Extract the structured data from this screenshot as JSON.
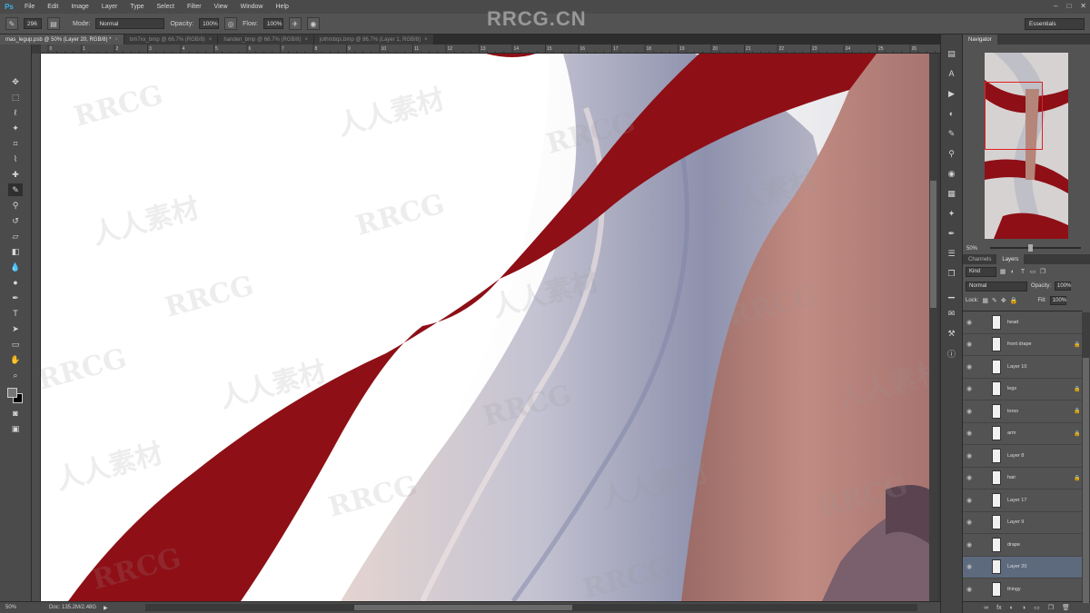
{
  "app": {
    "logo": "Ps",
    "menu": [
      "File",
      "Edit",
      "Image",
      "Layer",
      "Type",
      "Select",
      "Filter",
      "View",
      "Window",
      "Help"
    ],
    "window_controls": [
      "–",
      "□",
      "✕"
    ]
  },
  "options_bar": {
    "brush_size": "296",
    "mode_label": "Mode:",
    "mode_value": "Normal",
    "opacity_label": "Opacity:",
    "opacity_value": "100%",
    "flow_label": "Flow:",
    "flow_value": "100%",
    "workspace": "Essentials"
  },
  "tabs": [
    {
      "label": "mas_legup.psb @ 50% (Layer 20, RGB/8) *",
      "active": true
    },
    {
      "label": "bm7xx_bmp @ 66.7% (RGB/8)",
      "active": false
    },
    {
      "label": "handen_bmp @ 66.7% (RGB/8)",
      "active": false
    },
    {
      "label": "jothmbqs.bmp @ 86.7% (Layer 1, RGB/8)",
      "active": false
    }
  ],
  "ruler_top": [
    "0",
    "1",
    "2",
    "3",
    "4",
    "5",
    "6",
    "7",
    "8",
    "9",
    "10",
    "11",
    "12",
    "13",
    "14",
    "15",
    "16",
    "17",
    "18",
    "19",
    "20",
    "21",
    "22",
    "23",
    "24",
    "25",
    "26"
  ],
  "watermarks": {
    "site": "RRCG.CN",
    "repeat_a": "RRCG",
    "repeat_b": "人人素材"
  },
  "status": {
    "zoom": "50%",
    "doc": "Doc: 135.2M/2.48G"
  },
  "navigator": {
    "tab": "Navigator",
    "zoom": "50%"
  },
  "layers_panel": {
    "tabs": [
      "Channels",
      "Layers"
    ],
    "kind": "Kind",
    "blend_mode": "Normal",
    "opacity_label": "Opacity:",
    "opacity_value": "100%",
    "lock_label": "Lock:",
    "fill_label": "Fill:",
    "fill_value": "100%",
    "layers": [
      {
        "name": "head",
        "locked": false,
        "selected": false
      },
      {
        "name": "front drape",
        "locked": true,
        "selected": false
      },
      {
        "name": "Layer 10",
        "locked": false,
        "selected": false
      },
      {
        "name": "legs",
        "locked": true,
        "selected": false
      },
      {
        "name": "torso",
        "locked": true,
        "selected": false
      },
      {
        "name": "arm",
        "locked": true,
        "selected": false
      },
      {
        "name": "Layer 8",
        "locked": false,
        "selected": false
      },
      {
        "name": "hair",
        "locked": true,
        "selected": false
      },
      {
        "name": "Layer 17",
        "locked": false,
        "selected": false
      },
      {
        "name": "Layer 9",
        "locked": false,
        "selected": false
      },
      {
        "name": "drape",
        "locked": false,
        "selected": false
      },
      {
        "name": "Layer 20",
        "locked": false,
        "selected": true
      },
      {
        "name": "thingy",
        "locked": false,
        "selected": false
      }
    ],
    "footer_icons": [
      "∞",
      "fx",
      "◐",
      "◑",
      "▭",
      "❐",
      "🗑"
    ]
  },
  "colors": {
    "drape_red": "#8e0f16",
    "skin": "#b98079",
    "hair": "#cdc9cf",
    "accent": "#38b3e6"
  }
}
